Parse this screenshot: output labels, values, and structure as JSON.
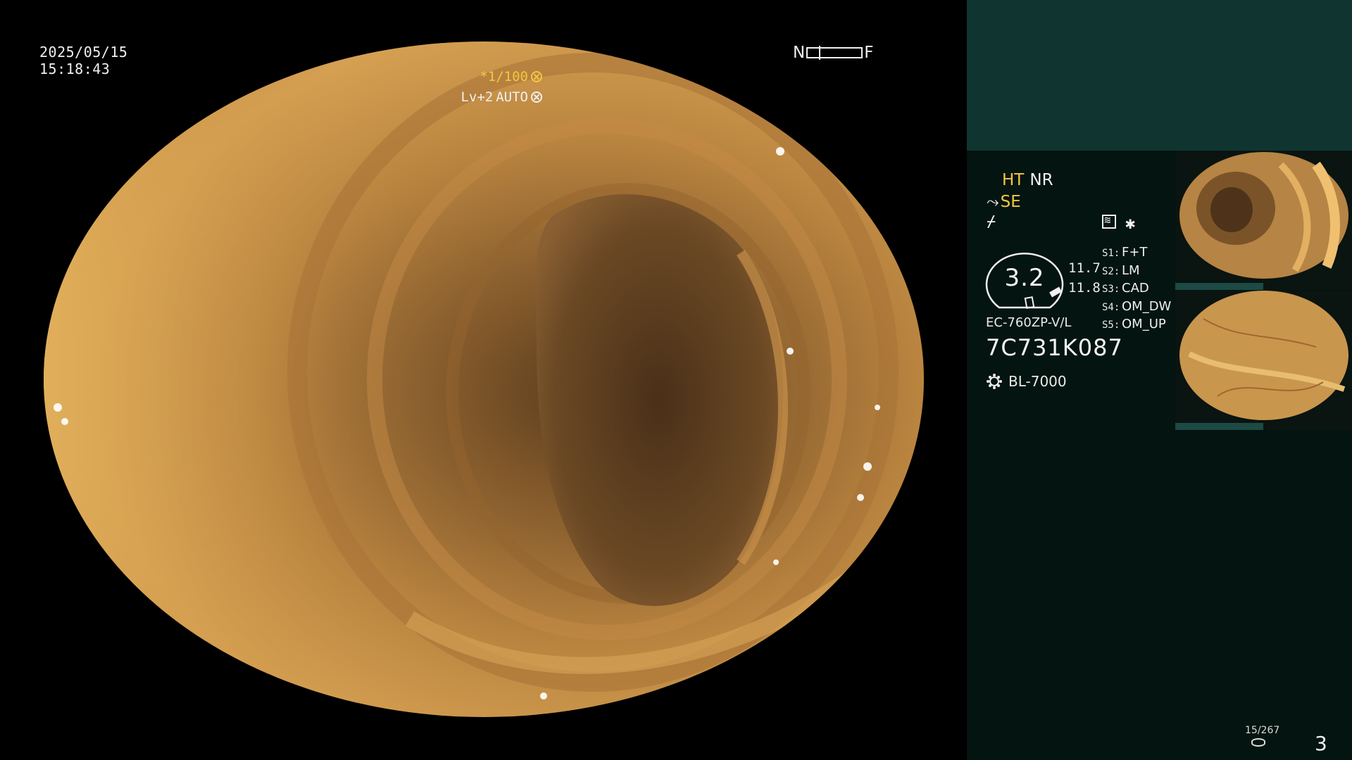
{
  "colors": {
    "background": "#000000",
    "panel": "#041410",
    "panel_header": "#103530",
    "accent_yellow": "#f5c642",
    "text": "#f0f0f0"
  },
  "main_view": {
    "date": "2025/05/15",
    "time": "15:18:43",
    "near_label": "N",
    "far_label": "F",
    "shutter": "*1/100",
    "level": "Lv+2",
    "mode": "AUTO",
    "shutter_icon": "dial-icon",
    "mode_icon": "dial-icon"
  },
  "info_panel": {
    "ht": "HT",
    "nr": "NR",
    "se_icon": "zoom-arrow-icon",
    "se": "SE",
    "flash_icon": "flash-icon",
    "wave_icon": "waveform-icon",
    "asterisk_icon": "asterisk-icon",
    "gauge_value": "3.2",
    "metric_1": "11.7",
    "metric_2": "11.8",
    "scope_model": "EC-760ZP-V/L",
    "scope_serial": "7C731K087",
    "light_icon": "sun-icon",
    "light_source": "BL-7000",
    "switches": [
      {
        "key": "S1:",
        "value": "F+T"
      },
      {
        "key": "S2:",
        "value": "LM"
      },
      {
        "key": "S3:",
        "value": "CAD"
      },
      {
        "key": "S4:",
        "value": "OM_DW"
      },
      {
        "key": "S5:",
        "value": "OM_UP"
      }
    ],
    "frame_counter": "15/267",
    "storage_icon": "storage-icon",
    "page_number": "3"
  }
}
